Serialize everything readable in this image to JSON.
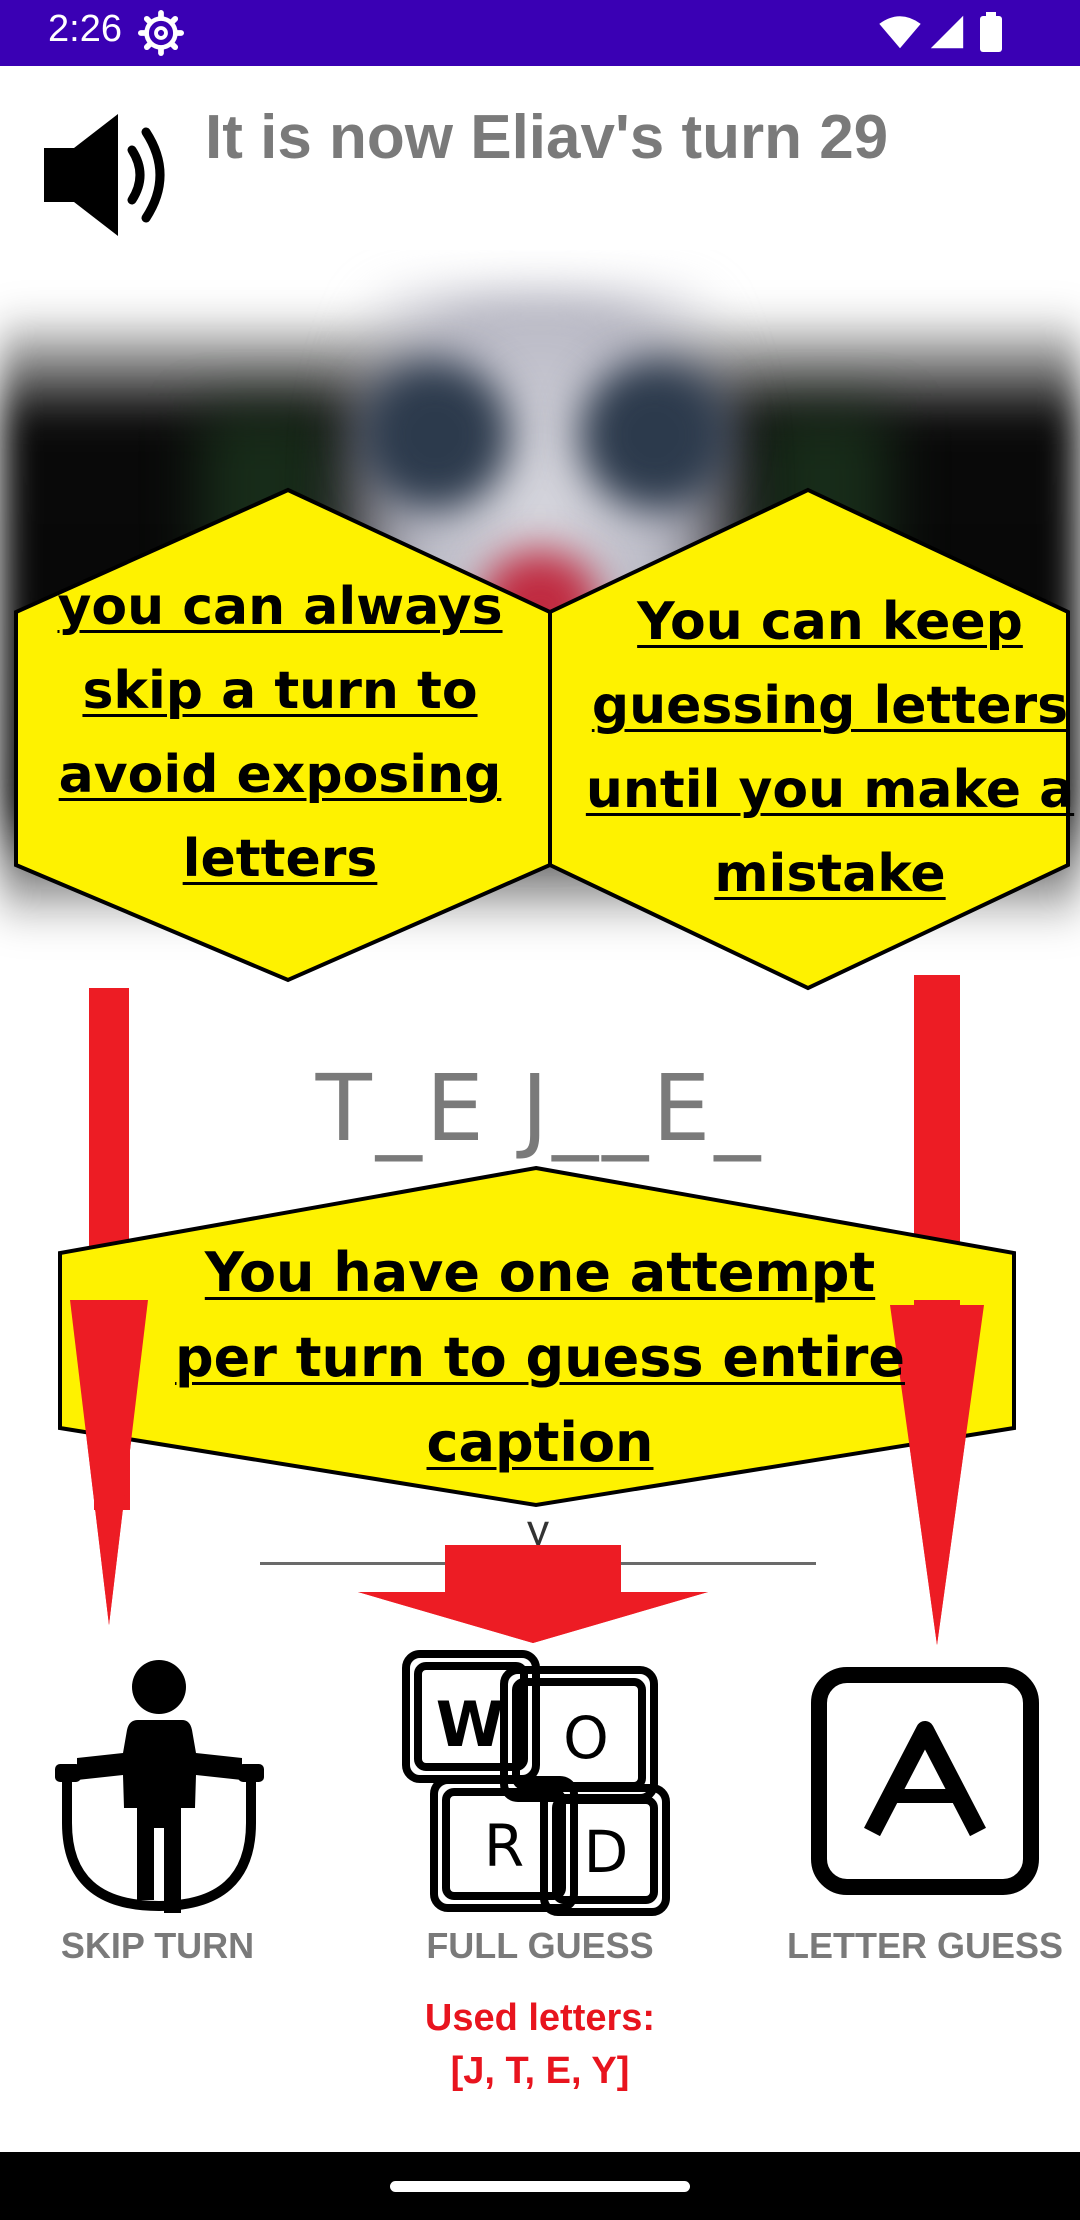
{
  "status_bar": {
    "time": "2:26"
  },
  "header": {
    "turn_text": "It is now Eliav's turn 29",
    "sound_icon": "speaker-volume-icon"
  },
  "tips": {
    "left": "you can always skip a turn to avoid exposing letters",
    "right": "You can keep guessing letters until you make a mistake",
    "center": "You have one attempt per turn to guess entire caption"
  },
  "puzzle": {
    "masked_caption": "T_E J__E_"
  },
  "guess_input": {
    "value": "y"
  },
  "actions": {
    "skip": {
      "label": "SKIP TURN",
      "icon": "jump-rope-icon"
    },
    "full_guess": {
      "label": "FULL GUESS",
      "icon": "word-blocks-icon"
    },
    "letter_guess": {
      "label": "LETTER GUESS",
      "icon": "letter-a-icon"
    }
  },
  "used_letters": {
    "label": "Used letters:",
    "value": "[J, T, E, Y]"
  },
  "colors": {
    "status_bar": "#3a00b4",
    "tip_fill": "#fef200",
    "arrow": "#ed1c24",
    "used_letters": "#e8141e",
    "label_gray": "#7a7a7a"
  }
}
